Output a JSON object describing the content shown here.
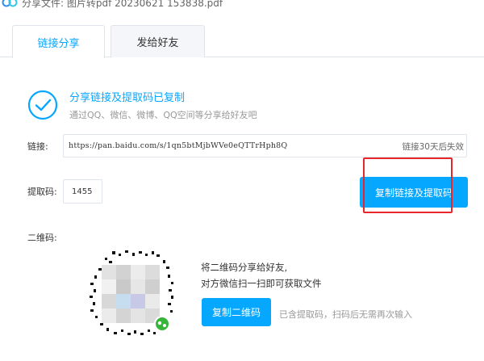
{
  "window": {
    "title": "分享文件: 图片转pdf 20230621 153838.pdf",
    "logo_icon": "baidu-netdisk-logo-icon"
  },
  "tabs": [
    {
      "label": "链接分享",
      "active": true
    },
    {
      "label": "发给好友",
      "active": false
    }
  ],
  "status": {
    "title": "分享链接及提取码已复制",
    "subtitle": "通过QQ、微信、微博、QQ空间等分享给好友吧",
    "icon": "check-circle-icon"
  },
  "link": {
    "label": "链接:",
    "url": "https://pan.baidu.com/s/1qn5btMjbWVe0eQTTrHph8Q",
    "expire": "链接30天后失效"
  },
  "code": {
    "label": "提取码:",
    "value": "1455"
  },
  "actions": {
    "copy_link_and_code": "复制链接及提取码",
    "copy_qr": "复制二维码"
  },
  "qr": {
    "label": "二维码:",
    "line1": "将二维码分享给好友,",
    "line2": "对方微信扫一扫即可获取文件",
    "hint": "已含提取码，扫码后无需再次输入"
  },
  "colors": {
    "accent": "#06a7ff",
    "highlight": "#e8262b",
    "wechat_badge": "#36b53a"
  }
}
